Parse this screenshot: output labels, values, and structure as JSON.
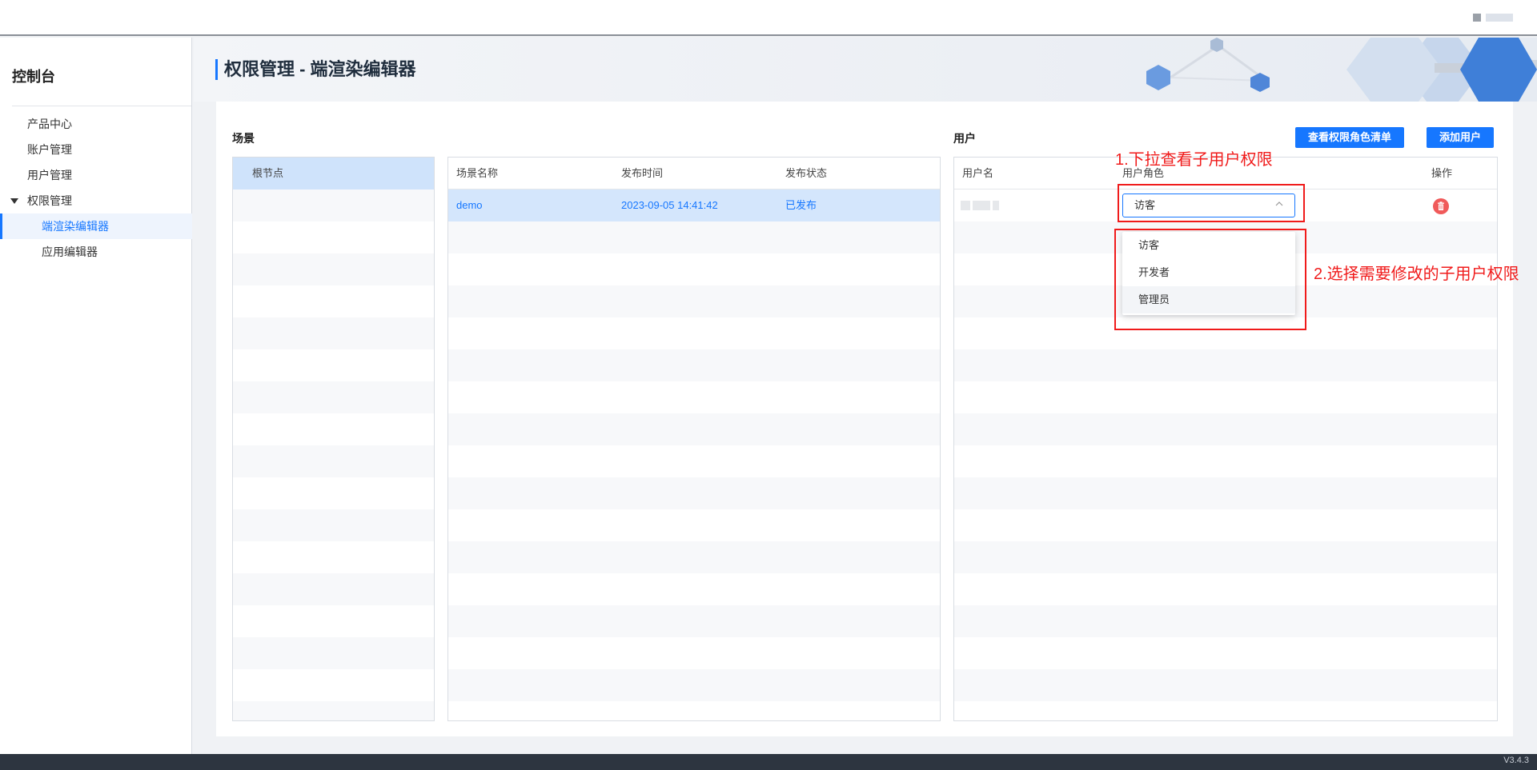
{
  "sidebar": {
    "title": "控制台",
    "items": [
      {
        "label": "产品中心"
      },
      {
        "label": "账户管理"
      },
      {
        "label": "用户管理"
      },
      {
        "label": "权限管理"
      },
      {
        "label": "端渲染编辑器"
      },
      {
        "label": "应用编辑器"
      }
    ]
  },
  "page": {
    "title": "权限管理 - 端渲染编辑器"
  },
  "scene_section": {
    "label": "场景",
    "tree_root": "根节点",
    "columns": [
      "场景名称",
      "发布时间",
      "发布状态"
    ],
    "rows": [
      {
        "name": "demo",
        "time": "2023-09-05 14:41:42",
        "status": "已发布"
      }
    ]
  },
  "user_section": {
    "label": "用户",
    "buttons": {
      "view_roles": "查看权限角色清单",
      "add_user": "添加用户"
    },
    "columns": [
      "用户名",
      "用户角色",
      "操作"
    ],
    "role_select": {
      "value": "访客",
      "options": [
        "访客",
        "开发者",
        "管理员"
      ]
    }
  },
  "annotations": {
    "step1": "1.下拉查看子用户权限",
    "step2": "2.选择需要修改的子用户权限"
  },
  "footer": {
    "version": "V3.4.3"
  },
  "colors": {
    "accent": "#1677ff",
    "annotation": "#f01b1b",
    "delete": "#f05a5a"
  }
}
